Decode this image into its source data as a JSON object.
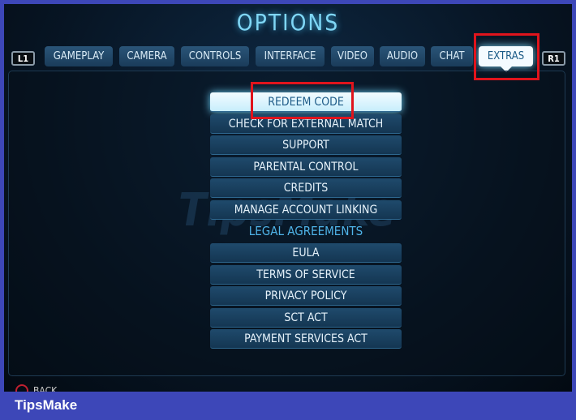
{
  "title": "OPTIONS",
  "bumpers": {
    "left": "L1",
    "right": "R1"
  },
  "tabs": [
    {
      "label": "GAMEPLAY"
    },
    {
      "label": "CAMERA"
    },
    {
      "label": "CONTROLS"
    },
    {
      "label": "INTERFACE"
    },
    {
      "label": "VIDEO"
    },
    {
      "label": "AUDIO"
    },
    {
      "label": "CHAT"
    },
    {
      "label": "EXTRAS",
      "active": true
    }
  ],
  "menu": {
    "items": [
      "REDEEM CODE",
      "CHECK FOR EXTERNAL MATCH",
      "SUPPORT",
      "PARENTAL CONTROL",
      "CREDITS",
      "MANAGE ACCOUNT LINKING"
    ],
    "legal_heading": "LEGAL AGREEMENTS",
    "legal_items": [
      "EULA",
      "TERMS OF SERVICE",
      "PRIVACY POLICY",
      "SCT ACT",
      "PAYMENT SERVICES ACT"
    ],
    "selected": "REDEEM CODE"
  },
  "footer": {
    "back_label": "BACK",
    "back_icon": "circle-button-icon"
  },
  "watermark": "TipsMake",
  "brand": "TipsMake",
  "colors": {
    "accent": "#7fd6f5",
    "highlight": "#e0141c",
    "brand_bar": "#3d47b8"
  }
}
